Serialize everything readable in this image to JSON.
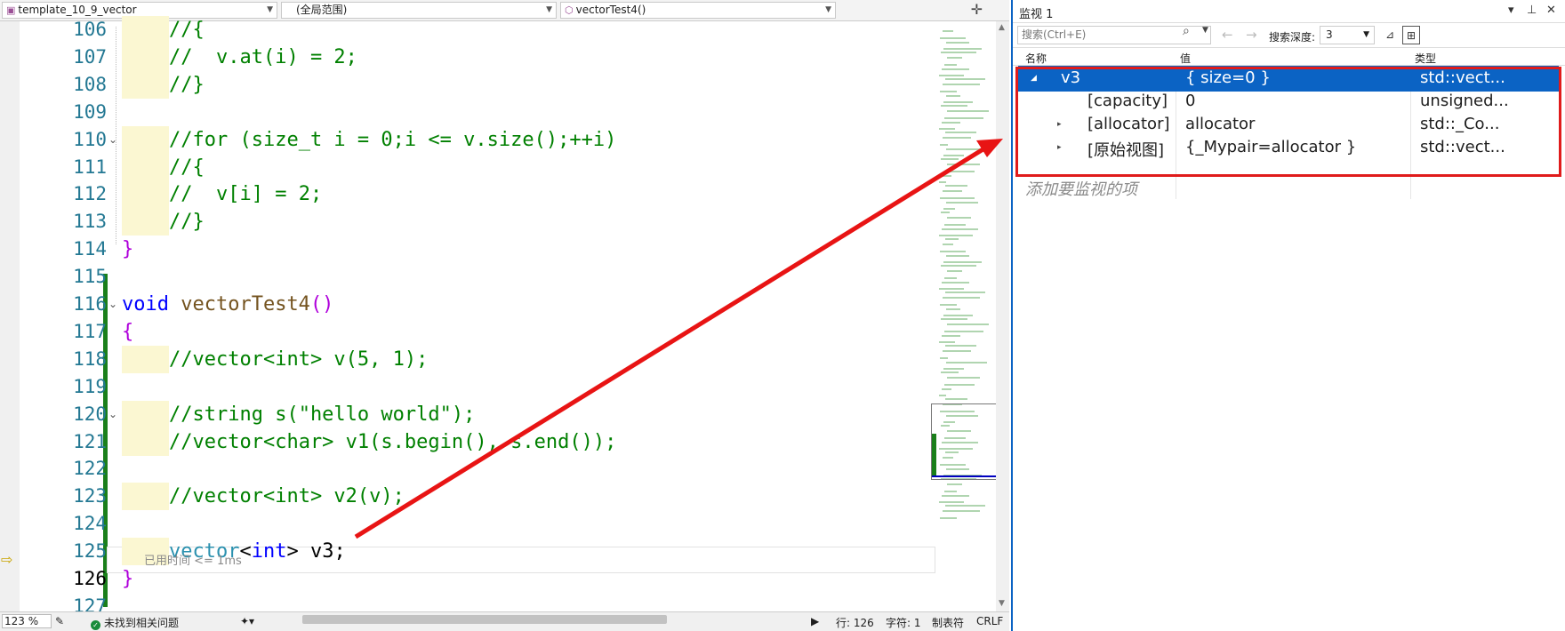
{
  "editor": {
    "nav": {
      "project": "template_10_9_vector",
      "scope": "(全局范围)",
      "function": "vectorTest4()"
    },
    "lines": [
      {
        "num": "106",
        "text": "//{",
        "cls": "cm"
      },
      {
        "num": "107",
        "text": "//  v.at(i) = 2;",
        "cls": "cm"
      },
      {
        "num": "108",
        "text": "//}",
        "cls": "cm"
      },
      {
        "num": "109",
        "text": "",
        "cls": ""
      },
      {
        "num": "110",
        "text": "//for (size_t i = 0;i <= v.size();++i)",
        "cls": "cm"
      },
      {
        "num": "111",
        "text": "//{",
        "cls": "cm"
      },
      {
        "num": "112",
        "text": "//  v[i] = 2;",
        "cls": "cm"
      },
      {
        "num": "113",
        "text": "//}",
        "cls": "cm"
      },
      {
        "num": "114",
        "text": "}",
        "cls": "br"
      },
      {
        "num": "115",
        "text": "",
        "cls": ""
      },
      {
        "num": "116",
        "text": "void vectorTest4()",
        "cls": "sig"
      },
      {
        "num": "117",
        "text": "{",
        "cls": "br"
      },
      {
        "num": "118",
        "text": "//vector<int> v(5, 1);",
        "cls": "cm"
      },
      {
        "num": "119",
        "text": "",
        "cls": ""
      },
      {
        "num": "120",
        "text": "//string s(\"hello world\");",
        "cls": "cm"
      },
      {
        "num": "121",
        "text": "//vector<char> v1(s.begin(), s.end());",
        "cls": "cm"
      },
      {
        "num": "122",
        "text": "",
        "cls": ""
      },
      {
        "num": "123",
        "text": "//vector<int> v2(v);",
        "cls": "cm"
      },
      {
        "num": "124",
        "text": "",
        "cls": ""
      },
      {
        "num": "125",
        "text": "vector<int> v3;",
        "cls": "decl"
      },
      {
        "num": "126",
        "text": "}",
        "cls": "br"
      },
      {
        "num": "127",
        "text": "",
        "cls": ""
      }
    ],
    "elapsed_hint": "已用时间 <= 1ms",
    "status": {
      "zoom": "123 %",
      "issues": "未找到相关问题",
      "row": "行: 126",
      "col": "字符: 1",
      "tab": "制表符",
      "eol": "CRLF"
    }
  },
  "watch": {
    "title": "监视 1",
    "search_placeholder": "搜索(Ctrl+E)",
    "depth_label": "搜索深度:",
    "depth_value": "3",
    "columns": {
      "name": "名称",
      "value": "值",
      "type": "类型"
    },
    "rows": [
      {
        "name": "v3",
        "value": "{ size=0 }",
        "type": "std::vect...",
        "selected": true,
        "expander": "◢"
      },
      {
        "name": "[capacity]",
        "value": "0",
        "type": "unsigned...",
        "selected": false,
        "expander": ""
      },
      {
        "name": "[allocator]",
        "value": "allocator",
        "type": "std::_Co...",
        "selected": false,
        "expander": "▸"
      },
      {
        "name": "[原始视图]",
        "value": "{_Mypair=allocator }",
        "type": "std::vect...",
        "selected": false,
        "expander": "▸"
      }
    ],
    "add_hint": "添加要监视的项"
  },
  "colors": {
    "accent": "#0b63c4",
    "highlight_box": "#e01b1b",
    "comment": "#008000",
    "keyword": "#0000ff",
    "type": "#2b91af"
  }
}
